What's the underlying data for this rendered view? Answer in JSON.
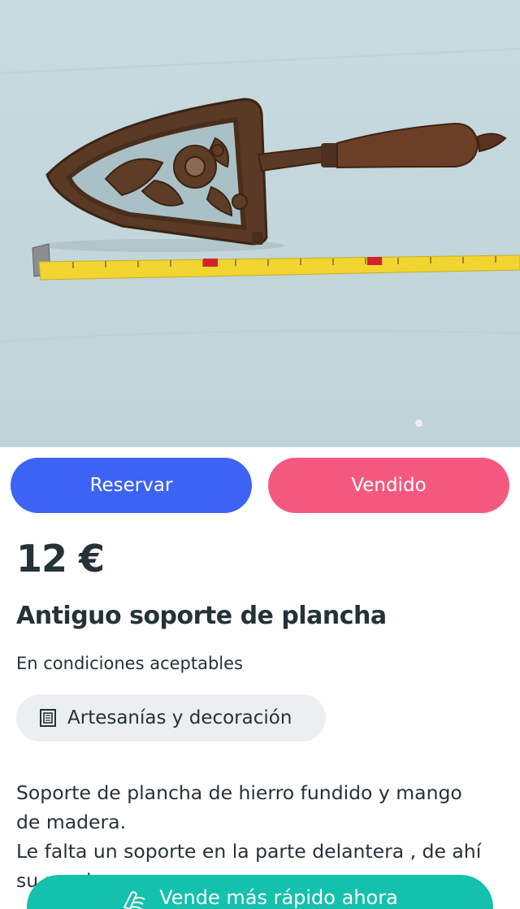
{
  "product": {
    "photo_alt": "Antiguo soporte de plancha",
    "price": "12 €",
    "title": "Antiguo soporte de plancha",
    "condition": "En condiciones aceptables",
    "category": {
      "label": "Artesanías y decoración",
      "icon": "frame-icon"
    },
    "description": [
      "Soporte de plancha de hierro fundido y mango",
      "de madera.",
      "Le falta un soporte en la parte delantera , de ahí",
      "su precio."
    ]
  },
  "actions": {
    "reserve_label": "Reservar",
    "sold_label": "Vendido",
    "sell_fast_label": "Vende más rápido ahora"
  },
  "colors": {
    "reserve": "#3c63f5",
    "sold": "#f5587e",
    "sell_fast": "#13c1ac",
    "text": "#253238",
    "chip_bg": "#eceff1"
  }
}
